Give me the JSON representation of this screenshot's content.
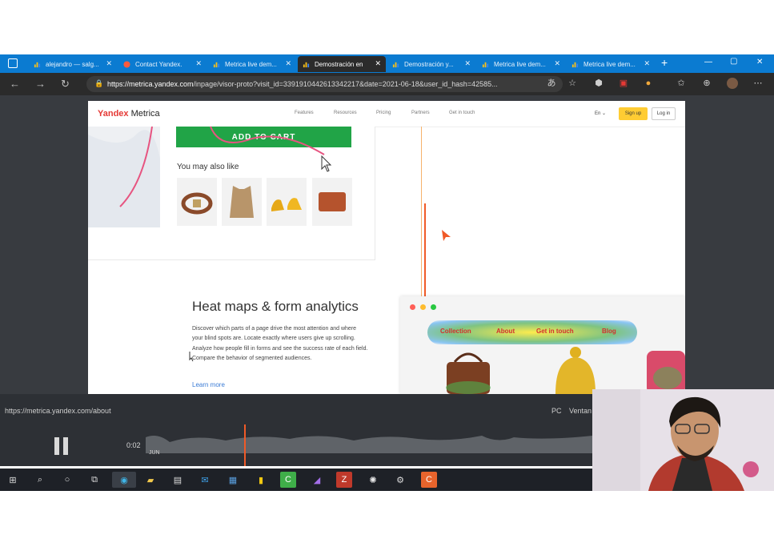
{
  "browser": {
    "tabs": [
      {
        "label": "alejandro — salg...",
        "active": false
      },
      {
        "label": "Contact Yandex.",
        "active": false
      },
      {
        "label": "Metrica live dem...",
        "active": false
      },
      {
        "label": "Demostración en",
        "active": true
      },
      {
        "label": "Demostración y...",
        "active": false
      },
      {
        "label": "Metrica live dem...",
        "active": false
      },
      {
        "label": "Metrica live dem...",
        "active": false
      }
    ],
    "url_host": "https://metrica.yandex.com",
    "url_path": "/inpage/visor-proto?visit_id=3391910442613342217&date=2021-06-18&user_id_hash=42585...",
    "new_tab": "+",
    "win_minimize": "—",
    "win_maximize": "▢",
    "win_close": "✕"
  },
  "site": {
    "logo_brand": "Yandex",
    "logo_product": "Metrica",
    "nav": [
      "Features",
      "Resources",
      "Pricing",
      "Partners",
      "Get in touch"
    ],
    "lang": "En",
    "signup": "Sign up",
    "login": "Log in",
    "cart_button": "ADD TO CART",
    "also_like": "You may also like",
    "section_title": "Heat maps & form analytics",
    "section_desc": "Discover which parts of a page drive the most attention and where your blind spots are. Locate exactly where users give up scrolling. Analyze how people fill in forms and see the success rate of each field. Compare the behavior of segmented audiences.",
    "learn_more": "Learn more",
    "heatmap_labels": [
      "Collection",
      "About",
      "Get in touch",
      "Blog"
    ]
  },
  "player": {
    "status_url": "https://metrica.yandex.com/about",
    "device": "PC",
    "window_label": "Ventan",
    "time": "0:02",
    "timeline_start": "JUN",
    "progress": 0.22
  },
  "colors": {
    "tabbar": "#0b7bd1",
    "chrome_dark": "#2b2b2b",
    "cart_green": "#21a447",
    "signup_yellow": "#ffcc33",
    "cursor_line": "#f05a28"
  }
}
